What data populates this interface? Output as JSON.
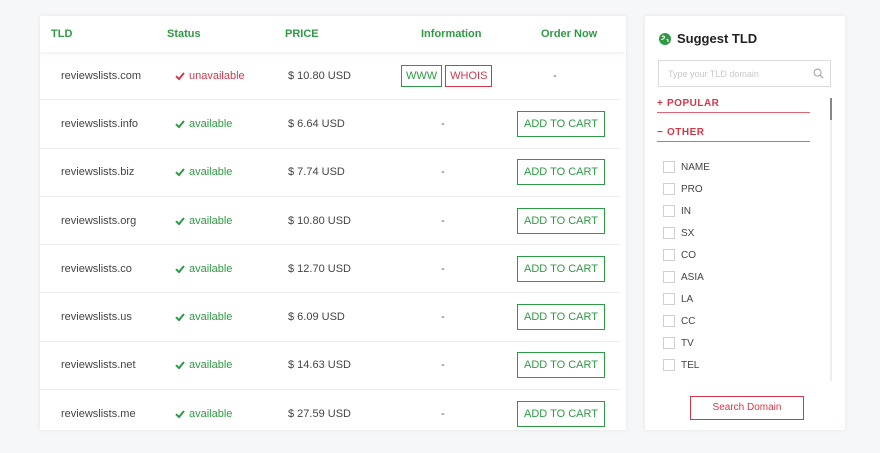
{
  "table": {
    "headers": {
      "tld": "TLD",
      "status": "Status",
      "price": "PRICE",
      "info": "Information",
      "order": "Order Now"
    },
    "rows": [
      {
        "domain": "reviewslists.com",
        "status": "unavailable",
        "available": false,
        "price": "$ 10.80 USD",
        "info": "",
        "www": "WWW",
        "whois": "WHOIS",
        "order": "-"
      },
      {
        "domain": "reviewslists.info",
        "status": "available",
        "available": true,
        "price": "$ 6.64 USD",
        "info": "-",
        "order": "ADD TO CART"
      },
      {
        "domain": "reviewslists.biz",
        "status": "available",
        "available": true,
        "price": "$ 7.74 USD",
        "info": "-",
        "order": "ADD TO CART"
      },
      {
        "domain": "reviewslists.org",
        "status": "available",
        "available": true,
        "price": "$ 10.80 USD",
        "info": "-",
        "order": "ADD TO CART"
      },
      {
        "domain": "reviewslists.co",
        "status": "available",
        "available": true,
        "price": "$ 12.70 USD",
        "info": "-",
        "order": "ADD TO CART"
      },
      {
        "domain": "reviewslists.us",
        "status": "available",
        "available": true,
        "price": "$ 6.09 USD",
        "info": "-",
        "order": "ADD TO CART"
      },
      {
        "domain": "reviewslists.net",
        "status": "available",
        "available": true,
        "price": "$ 14.63 USD",
        "info": "-",
        "order": "ADD TO CART"
      },
      {
        "domain": "reviewslists.me",
        "status": "available",
        "available": true,
        "price": "$ 27.59 USD",
        "info": "-",
        "order": "ADD TO CART"
      }
    ]
  },
  "sidebar": {
    "title": "Suggest TLD",
    "search_placeholder": "Type your TLD domain",
    "popular_label": "POPULAR",
    "popular_sign": "+",
    "other_label": "OTHER",
    "other_sign": "−",
    "options": [
      "NAME",
      "PRO",
      "IN",
      "SX",
      "CO",
      "ASIA",
      "LA",
      "CC",
      "TV",
      "TEL"
    ],
    "search_button": "Search Domain"
  },
  "colors": {
    "green": "#2f9a44",
    "red": "#d3384a"
  },
  "icons": {
    "status_ok": "check-icon",
    "status_bad": "check-icon",
    "title": "globe-icon",
    "search": "search-icon"
  }
}
